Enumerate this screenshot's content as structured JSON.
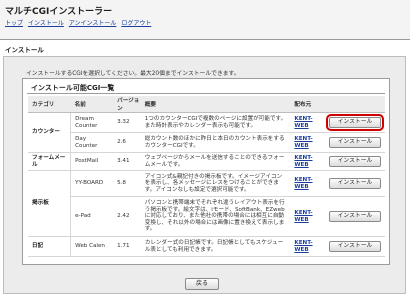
{
  "app": {
    "title": "マルチCGIインストーラー"
  },
  "nav": [
    {
      "label": "トップ"
    },
    {
      "label": "インストール"
    },
    {
      "label": "アンインストール"
    },
    {
      "label": "ログアウト"
    }
  ],
  "section": {
    "title": "インストール"
  },
  "intro": "インストールするCGIを選択してください。最大20個までインストールできます。",
  "card": {
    "title": "インストール可能CGI一覧"
  },
  "table": {
    "headers": [
      "カテゴリ",
      "名前",
      "バージョン",
      "概要",
      "配布元",
      ""
    ],
    "groups": [
      {
        "category": "カウンター",
        "rows": [
          {
            "name": "Dream Counter",
            "version": "3.32",
            "desc": "1つのカウンターCGIで複数のページに設置が可能です。また時計表示やカレンダー表示も可能です。",
            "source": "KENT-WEB",
            "button": "インストール",
            "highlight": true
          },
          {
            "name": "Day Counter",
            "version": "2.6",
            "desc": "総カウント数のほかに昨日と本日のカウント表示をするカウンターCGIです。",
            "source": "KENT-WEB",
            "button": "インストール",
            "highlight": false
          }
        ]
      },
      {
        "category": "フォームメール",
        "rows": [
          {
            "name": "PostMail",
            "version": "3.41",
            "desc": "ウェブページからメールを送信することのできるフォームメールです。",
            "source": "KENT-WEB",
            "button": "インストール",
            "highlight": false
          }
        ]
      },
      {
        "category": "掲示板",
        "rows": [
          {
            "name": "YY-BOARD",
            "version": "5.8",
            "desc": "アイコン式&親記付きの掲示板です。イメージアイコンを表示し、各メッセージにレスをつけることができます。アイコンなしも設定で選択可能です。",
            "source": "KENT-WEB",
            "button": "インストール",
            "highlight": false
          },
          {
            "name": "e-Pad",
            "version": "2.42",
            "desc": "パソコンと携帯端末でそれぞれ違うレイアウト表示を行う掲示板です。絵文字は、iモード、SoftBank、EZwebに対応しており、また他社の携帯の場合には相互に自動変換し、それ以外の場合には画像に置き換えて表示します。",
            "source": "KENT-WEB",
            "button": "インストール",
            "highlight": false
          }
        ]
      },
      {
        "category": "日記",
        "rows": [
          {
            "name": "Web Calen",
            "version": "1.71",
            "desc": "カレンダー式の日記帳です。日記帳としてもスケジュール表としても利用できます。",
            "source": "KENT-WEB",
            "button": "インストール",
            "highlight": false
          }
        ]
      }
    ]
  },
  "back": {
    "label": "戻る"
  },
  "colors": {
    "link": "#1a3f9c",
    "highlight": "#d00000",
    "panel": "#ececec"
  }
}
